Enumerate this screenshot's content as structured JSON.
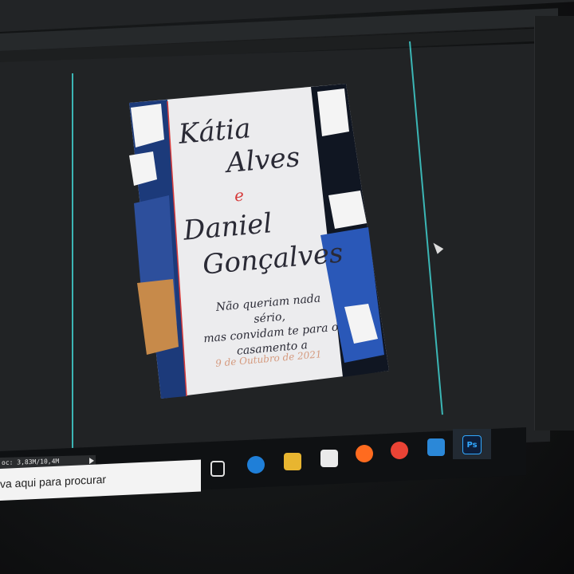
{
  "invitation": {
    "name1_first": "Kátia",
    "name1_last": "Alves",
    "conjunction": "e",
    "name2_first": "Daniel",
    "name2_last": "Gonçalves",
    "message_line1": "Não queriam nada sério,",
    "message_line2": "mas convidam te para o",
    "message_line3": "casamento a",
    "date": "9 de Outubro de 2021"
  },
  "status_bar": {
    "doc_size": "oc: 3,83M/10,4M"
  },
  "taskbar": {
    "search_placeholder": "va aqui para procurar",
    "photoshop_label": "Ps"
  },
  "colors": {
    "guide": "#3fd0cf",
    "accent_red": "#d63a3a",
    "date_color": "#d59a7e",
    "watercolor_blue": "#1c3a7a",
    "watercolor_gold": "#c78a4a"
  }
}
